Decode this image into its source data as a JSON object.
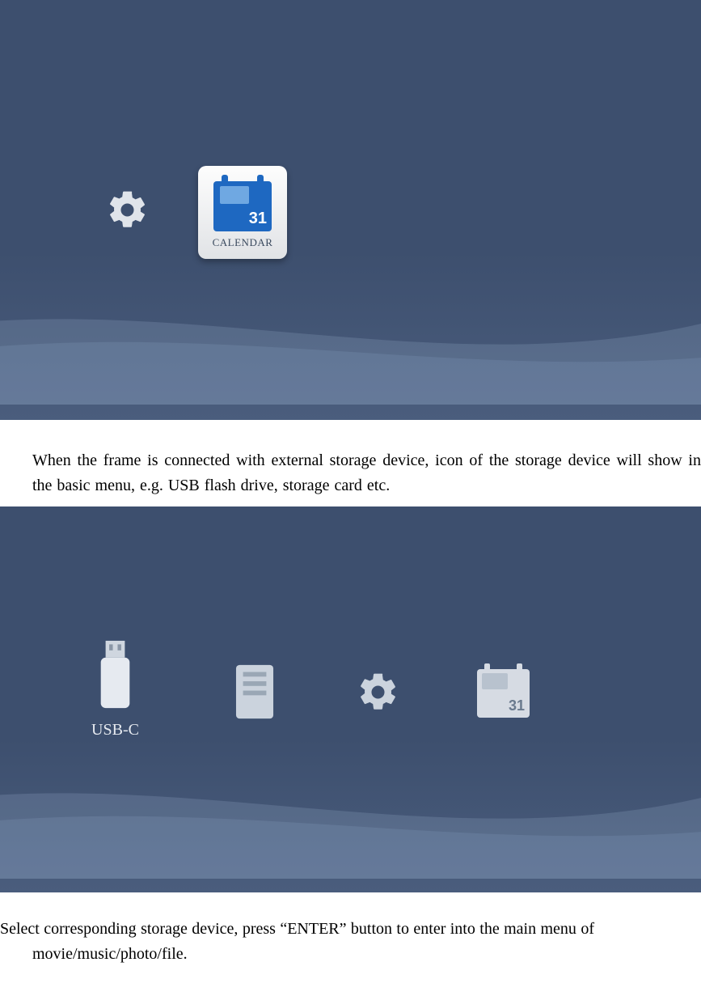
{
  "screenshot1": {
    "settings_icon_name": "settings",
    "calendar": {
      "day_number": "31",
      "label": "CALENDAR"
    }
  },
  "paragraph1": "When the frame is connected with external storage device, icon of the storage device will show in the basic menu, e.g. USB flash drive, storage card etc.",
  "screenshot2": {
    "usb": {
      "label": "USB-C"
    },
    "internal_storage_icon_name": "internal-storage",
    "settings_icon_name": "settings",
    "calendar": {
      "day_number": "31"
    }
  },
  "paragraph2_line1": "Select corresponding storage device, press “ENTER” button to enter into the main menu of",
  "paragraph2_line2": "movie/music/photo/file."
}
